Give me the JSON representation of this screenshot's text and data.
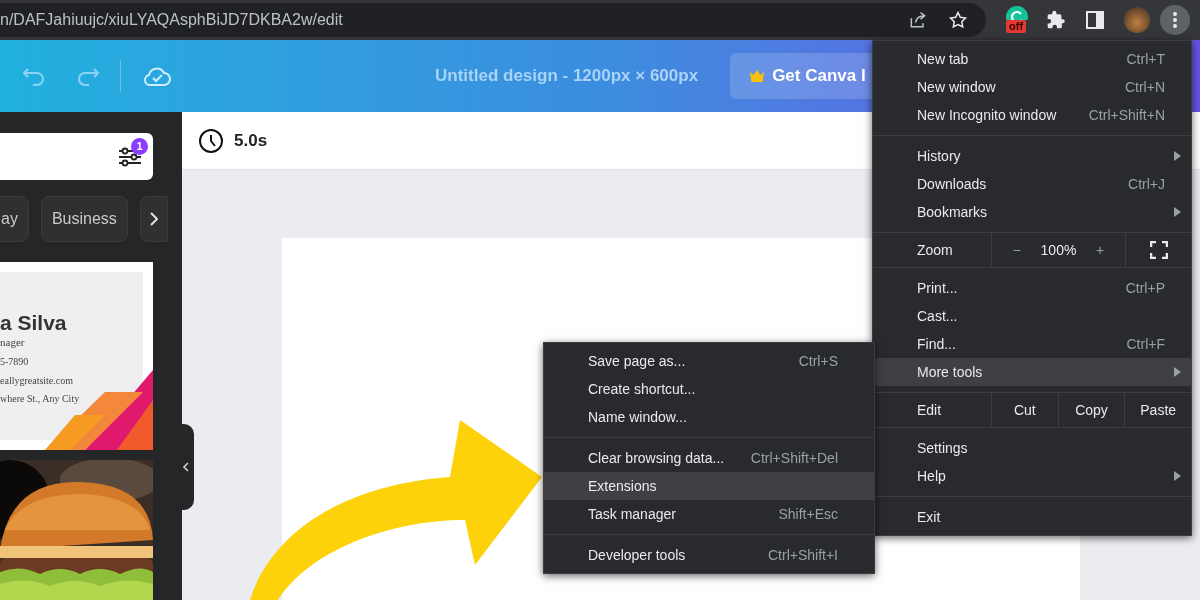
{
  "browser": {
    "url": "n/DAFJahiuujc/xiuLYAQAsphBiJD7DKBA2w/edit",
    "extension_badge": "off"
  },
  "editor_header": {
    "title": "Untitled design - 1200px × 600px",
    "upgrade_button": "Get Canva I"
  },
  "sidebar": {
    "filter_badge": "1",
    "chips": [
      {
        "label": "ay"
      },
      {
        "label": "Business"
      }
    ],
    "templates": [
      {
        "kind": "business_card",
        "name": "a Silva",
        "role": "nager",
        "details": [
          "5-7890",
          "eallygreatsite.com",
          "where St., Any City"
        ]
      },
      {
        "kind": "picture"
      }
    ]
  },
  "timing": {
    "duration": "5.0s"
  },
  "chrome_menu": {
    "sections": [
      {
        "items": [
          {
            "kind": "item",
            "label": "New tab",
            "shortcut": "Ctrl+T",
            "submenu": false,
            "selected": false
          },
          {
            "kind": "item",
            "label": "New window",
            "shortcut": "Ctrl+N",
            "submenu": false,
            "selected": false
          },
          {
            "kind": "item",
            "label": "New Incognito window",
            "shortcut": "Ctrl+Shift+N",
            "submenu": false,
            "selected": false
          }
        ]
      },
      {
        "items": [
          {
            "kind": "item",
            "label": "History",
            "submenu": true,
            "selected": false
          },
          {
            "kind": "item",
            "label": "Downloads",
            "shortcut": "Ctrl+J",
            "submenu": false,
            "selected": false
          },
          {
            "kind": "item",
            "label": "Bookmarks",
            "submenu": true,
            "selected": false
          }
        ]
      },
      {
        "items": [
          {
            "kind": "zoom",
            "label": "Zoom",
            "minus": "−",
            "value": "100%",
            "plus": "+"
          }
        ]
      },
      {
        "items": [
          {
            "kind": "item",
            "label": "Print...",
            "shortcut": "Ctrl+P",
            "submenu": false,
            "selected": false
          },
          {
            "kind": "item",
            "label": "Cast...",
            "submenu": false,
            "selected": false
          },
          {
            "kind": "item",
            "label": "Find...",
            "shortcut": "Ctrl+F",
            "submenu": false,
            "selected": false
          },
          {
            "kind": "item",
            "label": "More tools",
            "submenu": true,
            "selected": true
          }
        ]
      },
      {
        "items": [
          {
            "kind": "edit",
            "label": "Edit",
            "actions": [
              "Cut",
              "Copy",
              "Paste"
            ]
          }
        ]
      },
      {
        "items": [
          {
            "kind": "item",
            "label": "Settings",
            "submenu": false,
            "selected": false
          },
          {
            "kind": "item",
            "label": "Help",
            "submenu": true,
            "selected": false
          }
        ]
      },
      {
        "items": [
          {
            "kind": "item",
            "label": "Exit",
            "submenu": false,
            "selected": false
          }
        ]
      }
    ]
  },
  "more_tools_menu": {
    "sections": [
      {
        "items": [
          {
            "kind": "item",
            "label": "Save page as...",
            "shortcut": "Ctrl+S",
            "submenu": false,
            "selected": false
          },
          {
            "kind": "item",
            "label": "Create shortcut...",
            "submenu": false,
            "selected": false
          },
          {
            "kind": "item",
            "label": "Name window...",
            "submenu": false,
            "selected": false
          }
        ]
      },
      {
        "items": [
          {
            "kind": "item",
            "label": "Clear browsing data...",
            "shortcut": "Ctrl+Shift+Del",
            "submenu": false,
            "selected": false
          },
          {
            "kind": "item",
            "label": "Extensions",
            "submenu": false,
            "selected": true
          },
          {
            "kind": "item",
            "label": "Task manager",
            "shortcut": "Shift+Esc",
            "submenu": false,
            "selected": false
          }
        ]
      },
      {
        "items": [
          {
            "kind": "item",
            "label": "Developer tools",
            "shortcut": "Ctrl+Shift+I",
            "submenu": false,
            "selected": false
          }
        ]
      }
    ]
  }
}
